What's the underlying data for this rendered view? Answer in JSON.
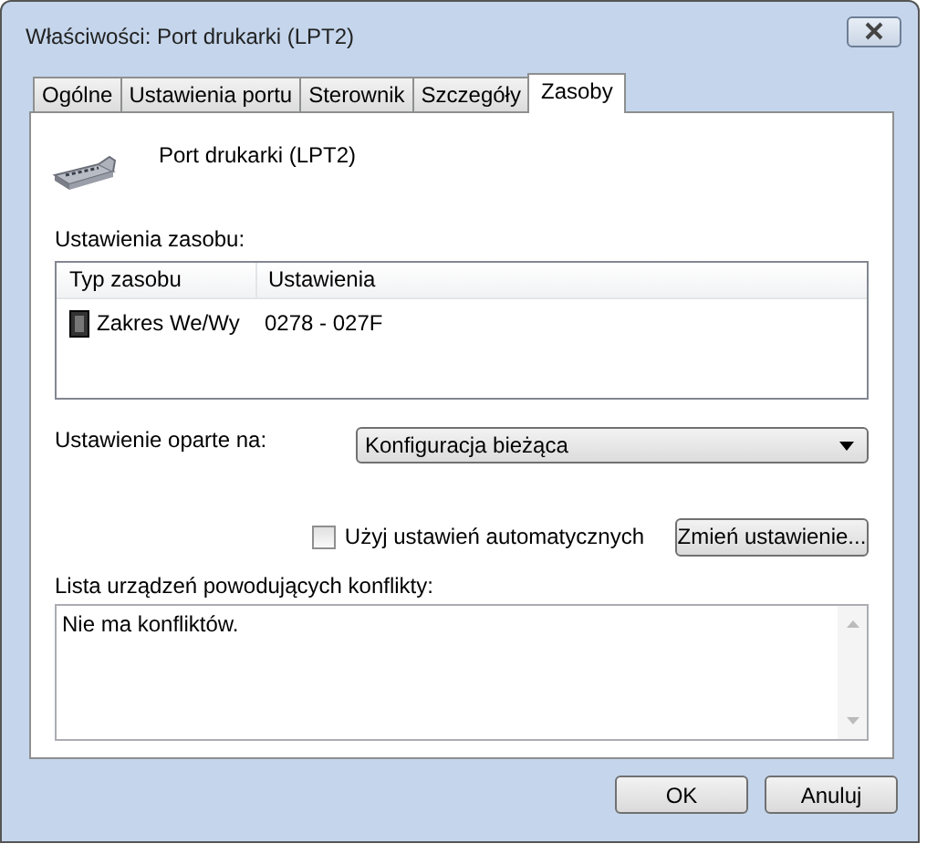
{
  "window": {
    "title": "Właściwości: Port drukarki (LPT2)"
  },
  "tabs": [
    {
      "label": "Ogólne",
      "selected": false
    },
    {
      "label": "Ustawienia portu",
      "selected": false
    },
    {
      "label": "Sterownik",
      "selected": false
    },
    {
      "label": "Szczegóły",
      "selected": false
    },
    {
      "label": "Zasoby",
      "selected": true
    }
  ],
  "device": {
    "name": "Port drukarki (LPT2)"
  },
  "resource_settings": {
    "label": "Ustawienia zasobu:",
    "columns": [
      "Typ zasobu",
      "Ustawienia"
    ],
    "rows": [
      {
        "type": "Zakres We/Wy",
        "setting": "0278 - 027F"
      }
    ]
  },
  "based_on": {
    "label": "Ustawienie oparte na:",
    "value": "Konfiguracja bieżąca"
  },
  "auto_settings": {
    "label": "Użyj ustawień automatycznych",
    "checked": false
  },
  "change_button": "Zmień ustawienie...",
  "conflicts": {
    "label": "Lista urządzeń powodujących konflikty:",
    "text": "Nie ma konfliktów."
  },
  "buttons": [
    "OK",
    "Anuluj"
  ]
}
